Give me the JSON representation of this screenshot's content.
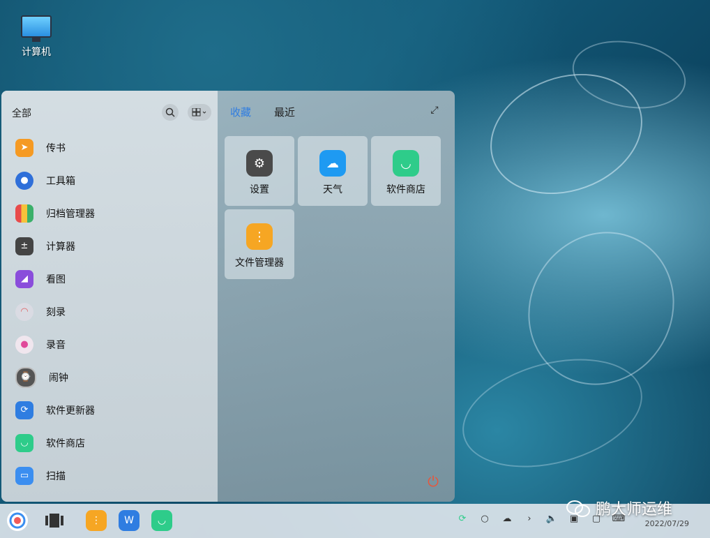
{
  "desktop": {
    "computer_label": "计算机"
  },
  "menu": {
    "left_title": "全部",
    "search_icon": "search-icon",
    "view_icon": "grid-view-icon",
    "apps": [
      {
        "label": "传书",
        "icon": "send-icon",
        "color": "#f59a23"
      },
      {
        "label": "工具箱",
        "icon": "toolbox-icon",
        "color": "#2f6fd9"
      },
      {
        "label": "归档管理器",
        "icon": "archive-icon",
        "color": "#e84b4b"
      },
      {
        "label": "计算器",
        "icon": "calculator-icon",
        "color": "#444444"
      },
      {
        "label": "看图",
        "icon": "image-viewer-icon",
        "color": "#8a4ddb"
      },
      {
        "label": "刻录",
        "icon": "disc-burner-icon",
        "color": "#c8c8d0"
      },
      {
        "label": "录音",
        "icon": "microphone-icon",
        "color": "#e04a9a"
      },
      {
        "label": "闹钟",
        "icon": "alarm-clock-icon",
        "color": "#555555"
      },
      {
        "label": "软件更新器",
        "icon": "update-icon",
        "color": "#2f7de1"
      },
      {
        "label": "软件商店",
        "icon": "store-icon",
        "color": "#2ecc8a"
      },
      {
        "label": "扫描",
        "icon": "scanner-icon",
        "color": "#3b8ef0"
      }
    ],
    "tabs": {
      "favorites": "收藏",
      "recent": "最近"
    },
    "favorites": [
      {
        "label": "设置",
        "icon": "settings-gear-icon",
        "color": "#4a4a4a"
      },
      {
        "label": "天气",
        "icon": "weather-icon",
        "color": "#1e9af2"
      },
      {
        "label": "软件商店",
        "icon": "store-icon",
        "color": "#2ecc8a"
      },
      {
        "label": "文件管理器",
        "icon": "file-manager-icon",
        "color": "#f6a623"
      }
    ],
    "expand_icon": "expand-icon",
    "power_icon": "power-icon"
  },
  "taskbar": {
    "apps": [
      {
        "name": "launcher-button",
        "icon": "logo-icon",
        "color": "#ffffff"
      },
      {
        "name": "multitask-view-button",
        "icon": "multitask-icon",
        "color": "#333333"
      },
      {
        "name": "file-manager-taskbar-button",
        "icon": "file-manager-icon",
        "color": "#f6a623"
      },
      {
        "name": "wps-taskbar-button",
        "icon": "wps-icon",
        "color": "#2f7de1"
      },
      {
        "name": "store-taskbar-button",
        "icon": "store-icon",
        "color": "#2ecc8a"
      }
    ],
    "date": "2022/07/29"
  },
  "watermark": "鹏大师运维"
}
